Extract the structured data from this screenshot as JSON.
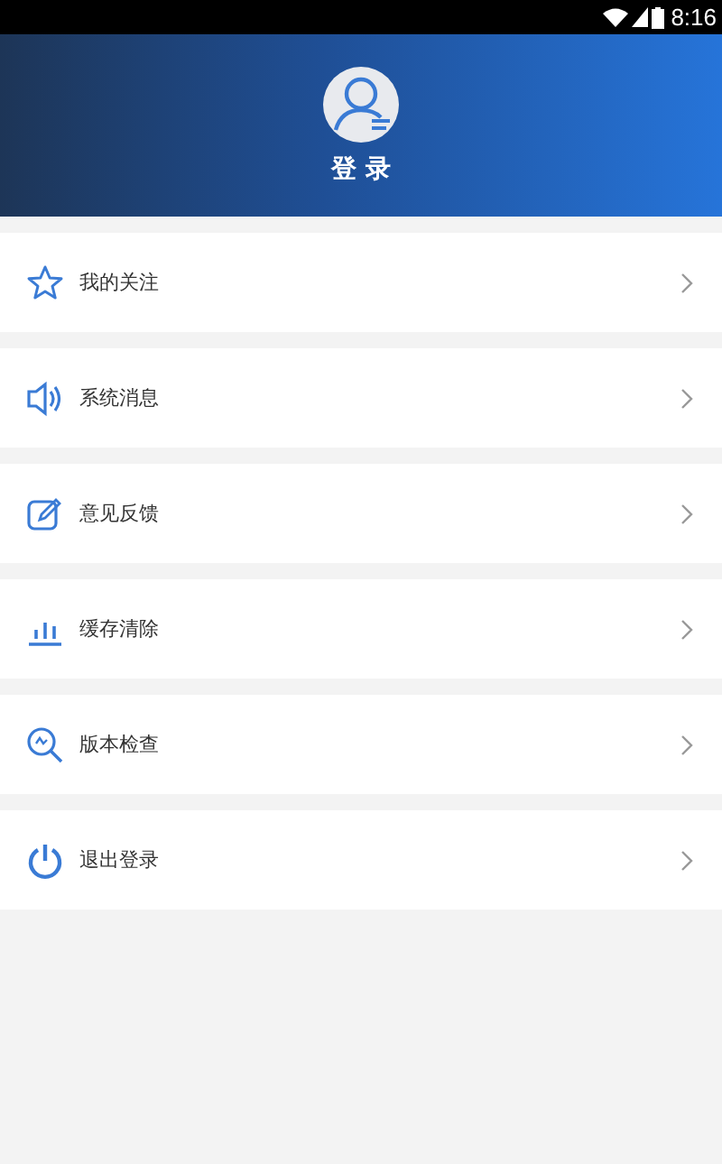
{
  "status_bar": {
    "time": "8:16"
  },
  "header": {
    "title": "登 录"
  },
  "menu": [
    {
      "kind": "star",
      "label": "我的关注"
    },
    {
      "kind": "speaker",
      "label": "系统消息"
    },
    {
      "kind": "edit",
      "label": "意见反馈"
    },
    {
      "kind": "bars",
      "label": "缓存清除"
    },
    {
      "kind": "search",
      "label": "版本检查"
    },
    {
      "kind": "power",
      "label": "退出登录"
    }
  ]
}
